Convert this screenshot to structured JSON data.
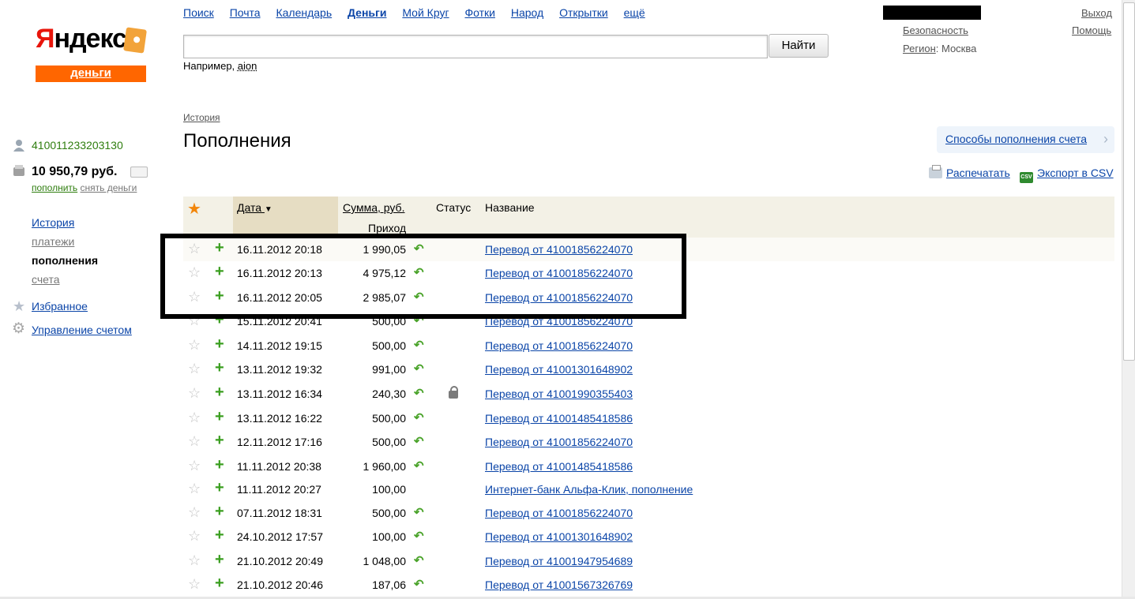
{
  "topnav": [
    {
      "label": "Поиск",
      "active": false
    },
    {
      "label": "Почта",
      "active": false
    },
    {
      "label": "Календарь",
      "active": false
    },
    {
      "label": "Деньги",
      "active": true
    },
    {
      "label": "Мой Круг",
      "active": false
    },
    {
      "label": "Фотки",
      "active": false
    },
    {
      "label": "Народ",
      "active": false
    },
    {
      "label": "Открытки",
      "active": false
    },
    {
      "label": "ещё",
      "active": false
    }
  ],
  "logo": {
    "brand_red": "Я",
    "brand_rest": "ндекс",
    "sub": "деньги"
  },
  "search": {
    "value": "",
    "button": "Найти",
    "hint_prefix": "Например,",
    "hint_link": "aion"
  },
  "top_right": {
    "security": "Безопасность",
    "region_label": "Регион",
    "region_value": ": Москва",
    "exit": "Выход",
    "help": "Помощь"
  },
  "sidebar": {
    "account_number": "410011233203130",
    "balance": "10 950,79 руб.",
    "topup": "пополнить",
    "withdraw": "снять деньги",
    "nav": {
      "history": "История",
      "payments": "платежи",
      "topups": "пополнения",
      "accounts": "счета"
    },
    "favorites": "Избранное",
    "manage": "Управление счетом"
  },
  "breadcrumb": "История",
  "page_title": "Пополнения",
  "methods_link": "Способы пополнения счета",
  "print_link": "Распечатать",
  "csv_link": "Экспорт в CSV",
  "table": {
    "headers": {
      "date": "Дата",
      "sort_arrow": "▼",
      "sum": "Сумма, руб.",
      "status": "Статус",
      "name": "Название",
      "income": "Приход"
    },
    "rows": [
      {
        "date": "16.11.2012 20:18",
        "sum": "1 990,05",
        "ret": true,
        "lock": false,
        "name": "Перевод от 41001856224070"
      },
      {
        "date": "16.11.2012 20:13",
        "sum": "4 975,12",
        "ret": true,
        "lock": false,
        "name": "Перевод от 41001856224070"
      },
      {
        "date": "16.11.2012 20:05",
        "sum": "2 985,07",
        "ret": true,
        "lock": false,
        "name": "Перевод от 41001856224070"
      },
      {
        "date": "15.11.2012 20:41",
        "sum": "500,00",
        "ret": true,
        "lock": false,
        "name": "Перевод от 41001856224070"
      },
      {
        "date": "14.11.2012 19:15",
        "sum": "500,00",
        "ret": true,
        "lock": false,
        "name": "Перевод от 41001856224070"
      },
      {
        "date": "13.11.2012 19:32",
        "sum": "991,00",
        "ret": true,
        "lock": false,
        "name": "Перевод от 41001301648902"
      },
      {
        "date": "13.11.2012 16:34",
        "sum": "240,30",
        "ret": true,
        "lock": true,
        "name": "Перевод от 41001990355403"
      },
      {
        "date": "13.11.2012 16:22",
        "sum": "500,00",
        "ret": true,
        "lock": false,
        "name": "Перевод от 41001485418586"
      },
      {
        "date": "12.11.2012 17:16",
        "sum": "500,00",
        "ret": true,
        "lock": false,
        "name": "Перевод от 41001856224070"
      },
      {
        "date": "11.11.2012 20:38",
        "sum": "1 960,00",
        "ret": true,
        "lock": false,
        "name": "Перевод от 41001485418586"
      },
      {
        "date": "11.11.2012 20:27",
        "sum": "100,00",
        "ret": false,
        "lock": false,
        "name": "Интернет-банк Альфа-Клик, пополнение"
      },
      {
        "date": "07.11.2012 18:31",
        "sum": "500,00",
        "ret": true,
        "lock": false,
        "name": "Перевод от 41001856224070"
      },
      {
        "date": "24.10.2012 17:57",
        "sum": "100,00",
        "ret": true,
        "lock": false,
        "name": "Перевод от 41001301648902"
      },
      {
        "date": "21.10.2012 20:49",
        "sum": "1 048,00",
        "ret": true,
        "lock": false,
        "name": "Перевод от 41001947954689"
      },
      {
        "date": "21.10.2012 20:46",
        "sum": "187,06",
        "ret": true,
        "lock": false,
        "name": "Перевод от 41001567326769"
      }
    ]
  },
  "colors": {
    "link": "#0b45a8",
    "logo_orange": "#ff6600",
    "plus_green": "#3a9e1f",
    "header_bg": "#f3f1e6"
  }
}
